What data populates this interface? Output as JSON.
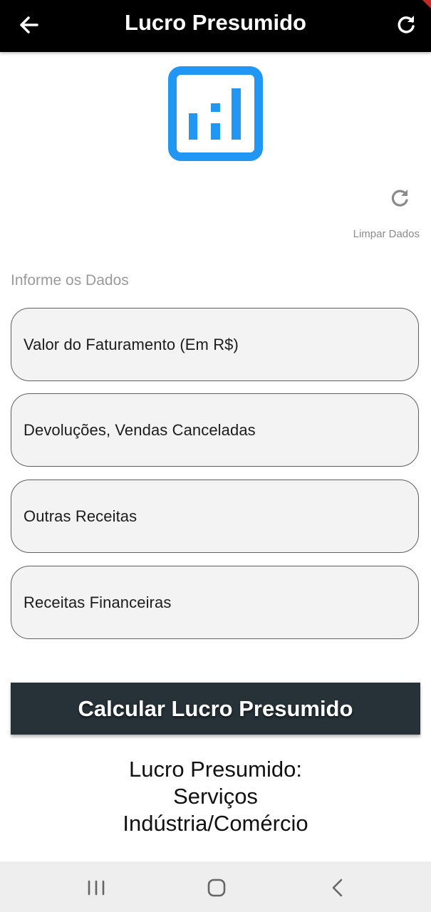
{
  "header": {
    "title": "Lucro Presumido",
    "back_icon": "arrow-left-icon",
    "reload_icon": "refresh-icon"
  },
  "logo": {
    "icon": "bar-chart-square-icon",
    "color": "#2196f3"
  },
  "clear": {
    "icon": "refresh-icon",
    "label": "Limpar Dados"
  },
  "form": {
    "section_label": "Informe os Dados",
    "fields": [
      {
        "placeholder": "Valor do Faturamento (Em R$)"
      },
      {
        "placeholder": "Devoluções, Vendas Canceladas"
      },
      {
        "placeholder": "Outras Receitas"
      },
      {
        "placeholder": "Receitas Financeiras"
      }
    ]
  },
  "calculate_button": {
    "label": "Calcular Lucro Presumido",
    "color": "#263238"
  },
  "result": {
    "line1": "Lucro Presumido:",
    "line2": "Serviços",
    "line3": "Indústria/Comércio"
  },
  "system_nav": {
    "recents_icon": "recent-apps-icon",
    "home_icon": "home-icon",
    "back_icon": "back-chevron-icon"
  }
}
